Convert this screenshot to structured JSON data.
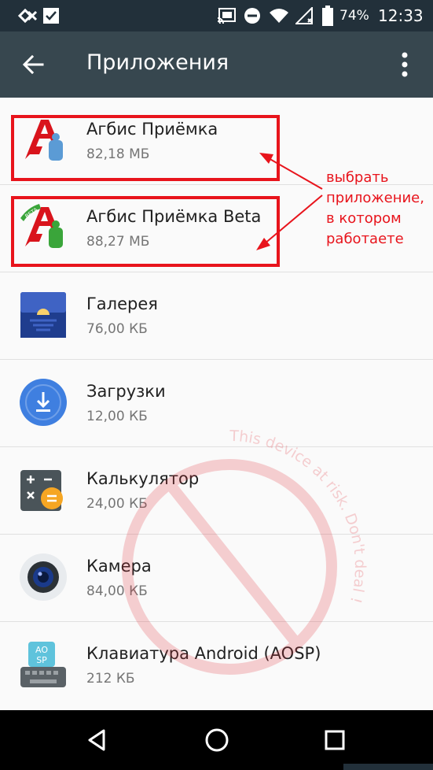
{
  "status_bar": {
    "battery_percent": "74%",
    "time": "12:33",
    "icons": [
      "app-notification-icon",
      "checkbox-notification-icon",
      "cast-icon",
      "do-not-disturb-icon",
      "wifi-icon",
      "signal-icon",
      "battery-icon"
    ]
  },
  "app_bar": {
    "title": "Приложения",
    "back_icon": "back-arrow-icon",
    "menu_icon": "more-vert-icon",
    "color": "#37474f"
  },
  "apps": [
    {
      "name": "Агбис Приёмка",
      "size": "82,18 МБ",
      "icon": "agbis-icon"
    },
    {
      "name": "Агбис Приёмка Beta",
      "size": "88,27 МБ",
      "icon": "agbis-beta-icon",
      "badge": "BETA"
    },
    {
      "name": "Галерея",
      "size": "76,00 КБ",
      "icon": "gallery-icon"
    },
    {
      "name": "Загрузки",
      "size": "12,00 КБ",
      "icon": "downloads-icon"
    },
    {
      "name": "Калькулятор",
      "size": "24,00 КБ",
      "icon": "calculator-icon"
    },
    {
      "name": "Камера",
      "size": "84,00 КБ",
      "icon": "camera-icon"
    },
    {
      "name": "Клавиатура Android (AOSP)",
      "size": "212 КБ",
      "icon": "keyboard-icon",
      "badge": "AOSP"
    }
  ],
  "annotation": {
    "text": "выбрать\nприложение,\nв котором\nработаете",
    "color": "#e8141c"
  },
  "watermark": {
    "text": "This device at risk. Don't deal !"
  },
  "nav_bar": {
    "icons": [
      "nav-back-icon",
      "nav-home-icon",
      "nav-recents-icon"
    ]
  }
}
